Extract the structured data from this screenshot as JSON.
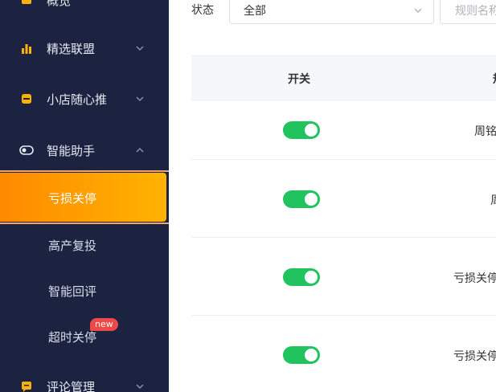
{
  "sidebar": {
    "items": [
      {
        "label": "概览",
        "icon": "home-icon"
      },
      {
        "label": "精选联盟",
        "icon": "bar-chart-icon"
      },
      {
        "label": "小店随心推",
        "icon": "store-icon"
      },
      {
        "label": "智能助手",
        "icon": "toggle-icon"
      },
      {
        "label": "评论管理",
        "icon": "comment-icon"
      }
    ],
    "subitems": [
      {
        "label": "亏损关停",
        "active": true
      },
      {
        "label": "高产复投"
      },
      {
        "label": "智能回评"
      },
      {
        "label": "超时关停",
        "badge": "new"
      }
    ]
  },
  "filter": {
    "status_label": "状态",
    "status_value": "全部",
    "search_placeholder": "规则名称"
  },
  "table": {
    "headers": [
      "开关",
      "规"
    ],
    "rows": [
      {
        "enabled": true,
        "name": "周铭"
      },
      {
        "enabled": true,
        "name": "周"
      },
      {
        "enabled": true,
        "name": "亏损关停"
      },
      {
        "enabled": true,
        "name": "亏损关停"
      }
    ]
  },
  "colors": {
    "sidebar_bg": "#1c2340",
    "accent": "#ff9800",
    "toggle_on": "#21c35e",
    "badge": "#f04848"
  }
}
